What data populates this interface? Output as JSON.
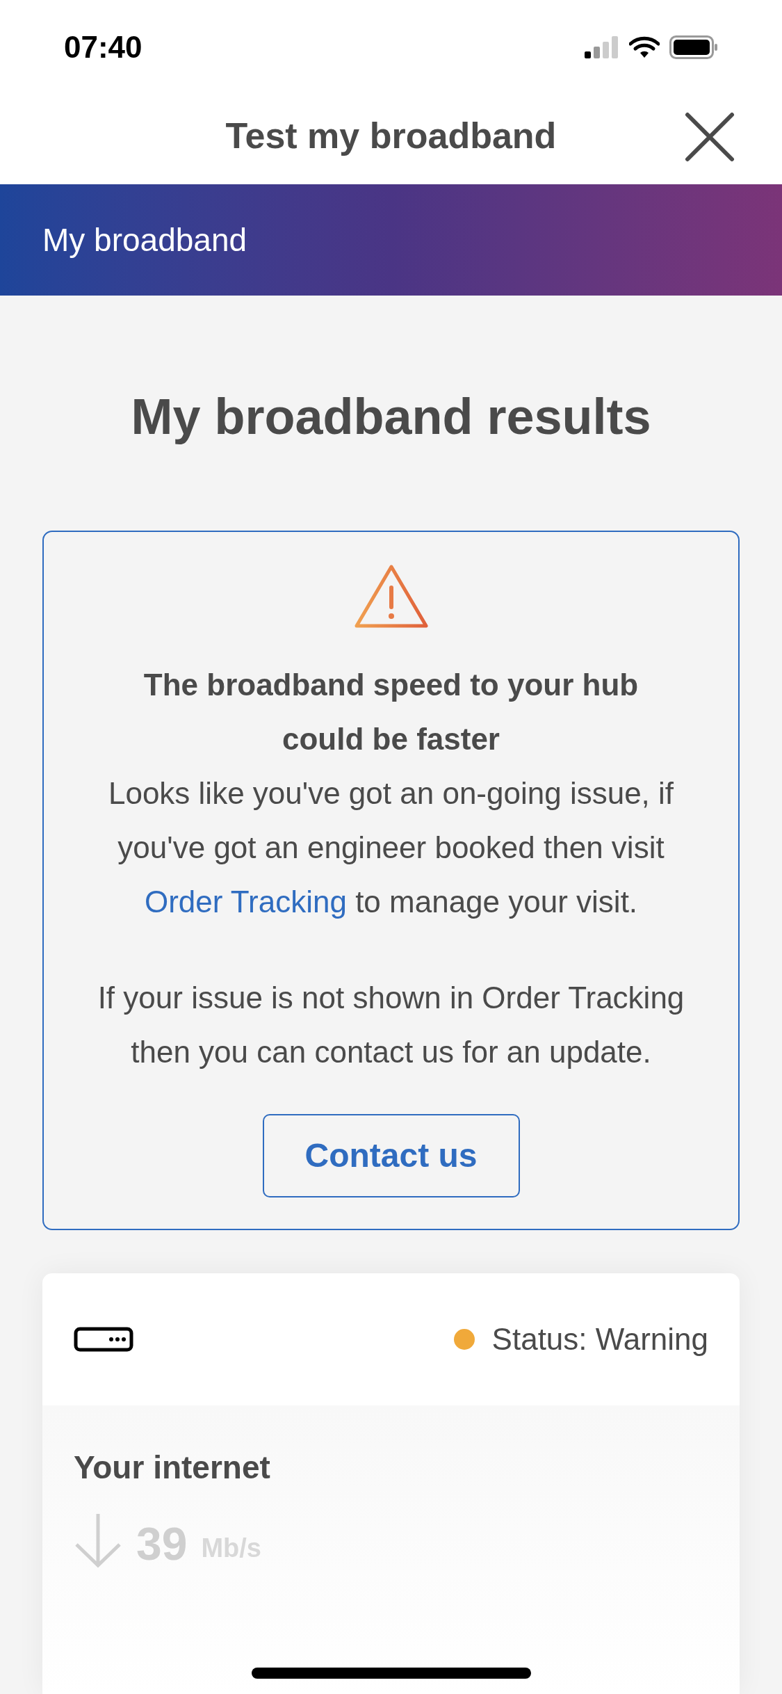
{
  "status_bar": {
    "time": "07:40"
  },
  "header": {
    "title": "Test my broadband"
  },
  "banner": {
    "title": "My broadband"
  },
  "heading": "My broadband results",
  "alert": {
    "title": "The broadband speed to your hub could be faster",
    "text_before": "Looks like you've got an on-going issue, if you've got an engineer booked then visit",
    "link": "Order Tracking",
    "text_after": "to manage your visit.",
    "note": "If your issue is not shown in Order Tracking then you can contact us for an update.",
    "button": "Contact us"
  },
  "device_card": {
    "status": {
      "label": "Status: Warning",
      "color": "#f0a93a"
    },
    "section_title": "Your internet",
    "speed": {
      "value": "39",
      "unit": "Mb/s"
    }
  }
}
